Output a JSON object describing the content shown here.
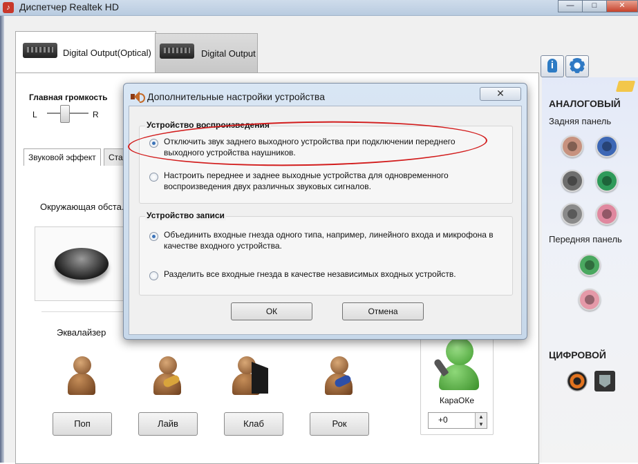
{
  "window": {
    "title": "Диспетчер Realtek HD",
    "minimize": "—",
    "maximize": "□",
    "close": "✕",
    "icon": "speaker-icon"
  },
  "device_tabs": [
    {
      "label": "Digital Output(Optical)",
      "icon": "digital-device-icon",
      "selected": true
    },
    {
      "label": "Digital Output",
      "icon": "digital-device-icon",
      "selected": false
    }
  ],
  "background": {
    "volume_label": "Главная громкость",
    "left": "L",
    "right": "R",
    "tab_sound_effect": "Звуковой эффект",
    "tab_standard_partial": "Ста",
    "environment_label": "Окружающая обста.",
    "equalizer_label": "Эквалайзер",
    "presets": [
      "Поп",
      "Лайв",
      "Клаб",
      "Рок"
    ],
    "karaoke_label": "КараОКе",
    "karaoke_value": "+0"
  },
  "right_panel": {
    "analog_heading": "АНАЛОГОВЫЙ",
    "rear_panel": "Задняя панель",
    "front_panel": "Передняя панель",
    "digital_heading": "ЦИФРОВОЙ",
    "rear_jack_colors": [
      "#c7927f",
      "#3d67b5",
      "#6e6e6e",
      "#2f9a5a",
      "#8a8a8a",
      "#e0889f"
    ],
    "front_jack_colors": [
      "#4aa860",
      "#e599a8"
    ]
  },
  "dialog": {
    "title": "Дополнительные настройки устройства",
    "close": "✕",
    "playback_group": "Устройство воспроизведения",
    "playback_options": [
      {
        "text": "Отключить звук заднего выходного устройства при подключении переднего выходного устройства наушников.",
        "checked": true
      },
      {
        "text": "Настроить переднее и заднее выходные устройства для одновременного воспроизведения двух различных звуковых сигналов.",
        "checked": false
      }
    ],
    "record_group": "Устройство записи",
    "record_options": [
      {
        "text": "Объединить входные гнезда одного типа, например, линейного входа и микрофона в качестве входного устройства.",
        "checked": true
      },
      {
        "text": "Разделить все входные гнезда в качестве независимых входных устройств.",
        "checked": false
      }
    ],
    "ok": "ОК",
    "cancel": "Отмена"
  },
  "annotation": {
    "highlight_color": "#d21c1c"
  }
}
